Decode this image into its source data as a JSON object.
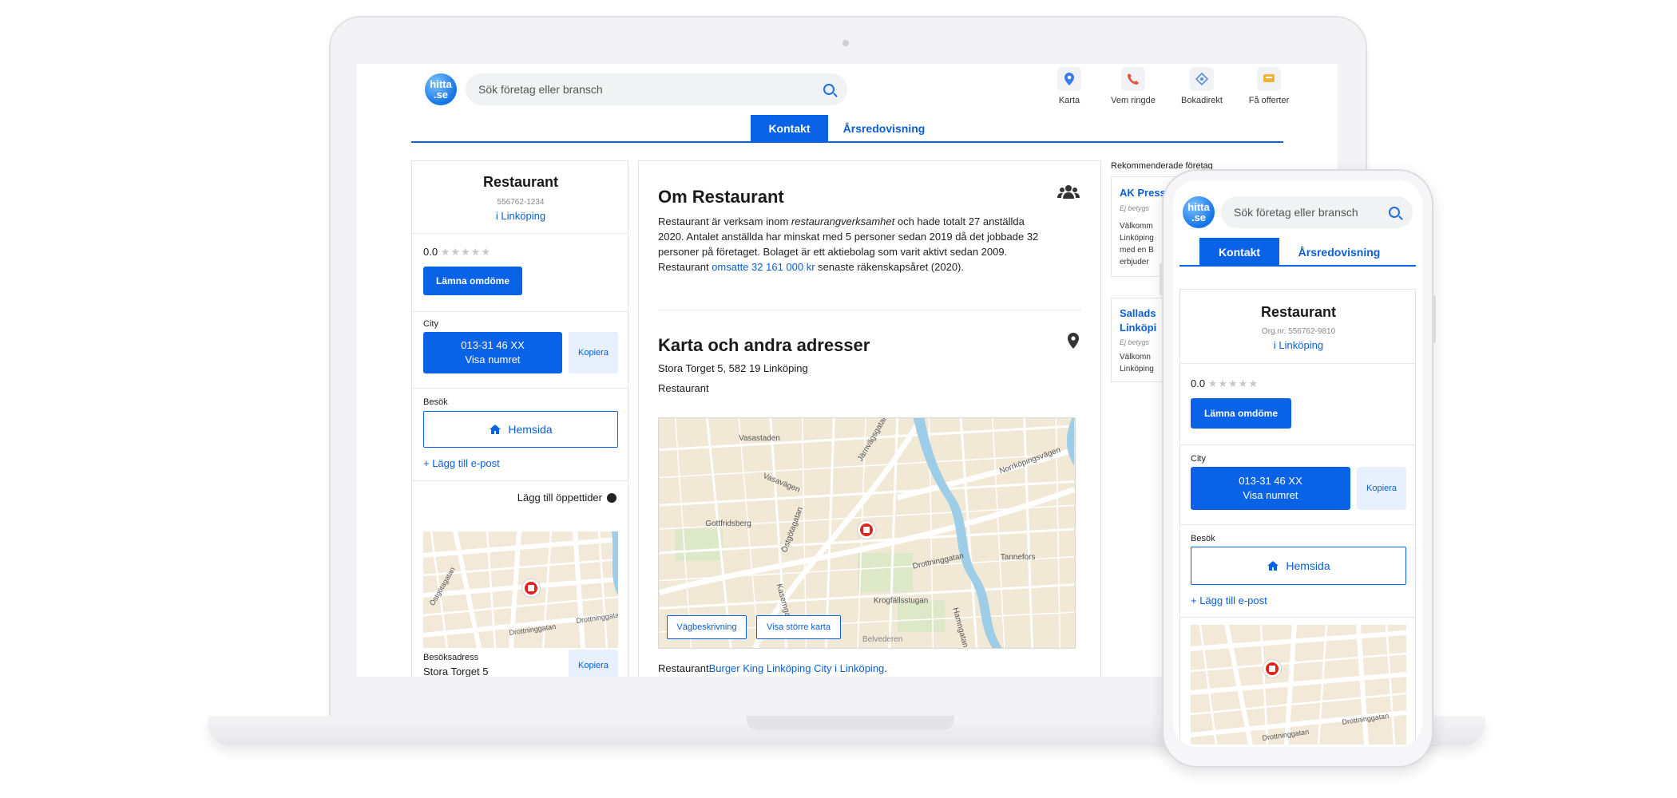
{
  "header": {
    "search_placeholder": "Sök företag eller bransch",
    "logo_text_1": "hitta",
    "logo_text_2": ".se",
    "nav": [
      {
        "label": "Karta",
        "icon": "map-pin-icon"
      },
      {
        "label": "Vem ringde",
        "icon": "phone-icon"
      },
      {
        "label": "Bokadirekt",
        "icon": "booking-icon"
      },
      {
        "label": "Få offerter",
        "icon": "offer-icon"
      }
    ]
  },
  "tabs": {
    "contact": "Kontakt",
    "annual_report": "Årsredovisning"
  },
  "company": {
    "name": "Restaurant",
    "org_nr": "556762-1234",
    "org_nr_mobile": "Org.nr. 556762-9810",
    "city": "i Linköping",
    "rating": "0.0",
    "review_button": "Lämna omdöme",
    "phone_label": "City",
    "phone_number": "013-31 46 XX",
    "show_number": "Visa numret",
    "copy": "Kopiera",
    "visit_label": "Besök",
    "homepage": "Hemsida",
    "add_email": "+ Lägg till e-post",
    "add_hours": "Lägg till öppettider",
    "visit_address_label": "Besöksadress",
    "visit_address": "Stora Torget 5"
  },
  "about": {
    "title": "Om Restaurant",
    "p1": "Restaurant är verksam inom ",
    "p1_em": "restaurangverksamhet",
    "p1_rest": " och hade totalt 27 anställda 2020. Antalet anställda har minskat med 5 personer sedan 2019 då det jobbade 32 personer på företaget. Bolaget är ett aktiebolag som varit aktivt sedan 2009. Restaurant ",
    "p1_link": "omsatte 32 161 000 kr",
    "p1_end": " senaste räkenskapsåret (2020)."
  },
  "map_section": {
    "title": "Karta och andra adresser",
    "address": "Stora Torget 5, 582 19 Linköping",
    "name": "Restaurant",
    "directions": "Vägbeskrivning",
    "bigger_map": "Visa större karta",
    "footer_prefix": "Restaurant",
    "footer_link": "Burger King Linköping City i Linköping",
    "footer_end": ".",
    "street_labels": [
      "Vasastaden",
      "Järnvägsgatan",
      "Vasavägen",
      "Norrköpingsvägen",
      "Gottfridsberg",
      "Östgötagatan",
      "Drottninggatan",
      "Tannefors",
      "Krogfällsstugan",
      "Hamngatan",
      "Kaserngatan",
      "Belvederen"
    ]
  },
  "side_map_labels": [
    "Östgötagatan",
    "Drottninggatan",
    "Drottninggatan"
  ],
  "recommended": {
    "title": "Rekommenderade företag",
    "items": [
      {
        "name": "AK Press",
        "rating": "Ej betygs",
        "desc": [
          "Välkomm",
          "Linköping",
          "med en B",
          "erbjuder"
        ]
      },
      {
        "name": "Sallads",
        "name2": "Linköpi",
        "rating": "Ej betygs",
        "desc": [
          "Välkomn",
          "Linköping"
        ]
      }
    ]
  },
  "colors": {
    "brand_blue": "#0a63e6",
    "pin_red": "#e2231a"
  }
}
